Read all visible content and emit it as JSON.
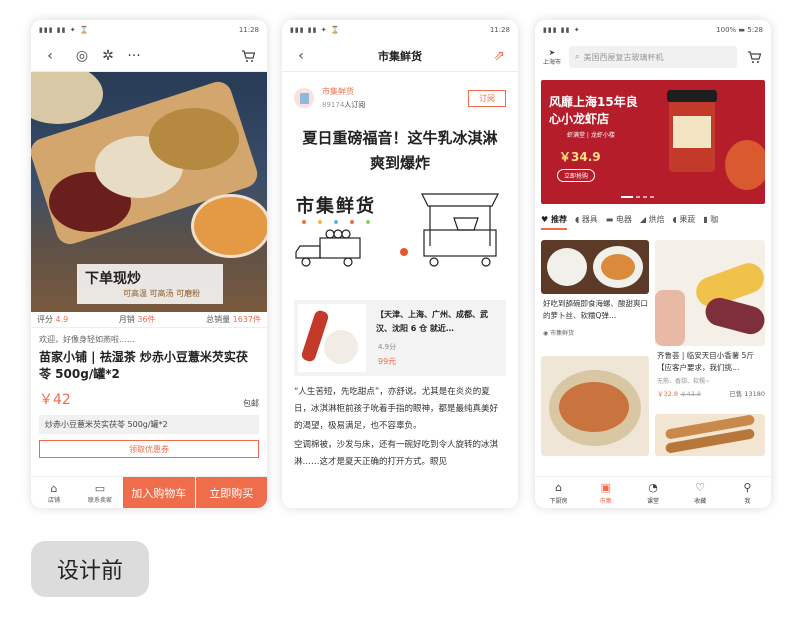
{
  "status_bar": {
    "time": "11:28",
    "time3": "5:28",
    "battery3": "100%"
  },
  "phone1": {
    "hero_title": "下单现炒",
    "hero_tags": "可高温  可高汤  可磨粉",
    "rating_label": "评分",
    "rating": "4.9",
    "sales_label": "月销",
    "sales": "36件",
    "total_label": "总销量",
    "total": "1637件",
    "note": "欢迎，好像身轻如燕啦……",
    "product_title": "苗家小铺 | 祛湿茶 炒赤小豆薏米芡实茯苓 500g/罐*2",
    "price": "￥42",
    "shipping": "包邮",
    "spec": "炒赤小豆薏米芡实茯苓 500g/罐*2",
    "coupon": "领取优惠券",
    "store_label": "店铺",
    "contact_label": "联系卖家",
    "add_cart": "加入购物车",
    "buy_now": "立即购买"
  },
  "phone2": {
    "title": "市集鲜货",
    "account_name": "市集鲜货",
    "subscribers": "89174",
    "subscribers_suffix": "人订阅",
    "subscribe": "订阅",
    "headline": "夏日重磅福音！这牛乳冰淇淋爽到爆炸",
    "brand": "市集鲜货",
    "card_title": "【天津、上海、广州、成都、武汉、沈阳 6 仓 就近…",
    "card_score": "4.9分",
    "card_price": "99元",
    "para1": "“人生苦短，先吃甜点”，亦舒说。尤其是在炎炎的夏日，冰淇淋柜前孩子吮着手指的眼神，都是最纯真美好的渴望，极易满足，也不容辜负。",
    "para2": "空调棉被，沙发与床，还有一碗好吃到令人旋转的冰淇淋……这才是夏天正确的打开方式。眼见"
  },
  "phone3": {
    "location": "上海市",
    "search_placeholder": "美国西屋复古玻璃杯机",
    "banner_title": "风靡上海15年良心小龙虾店",
    "banner_sub": "虾满堂 | 龙虾小楼",
    "banner_price": "￥34.9",
    "banner_btn": "立即抢购",
    "categories": [
      "推荐",
      "器具",
      "电器",
      "烘焙",
      "果蔬",
      "咖"
    ],
    "item1_title": "好吃到舔碗即食海螺、酸甜爽口的萝卜丝、软糯Q弹…",
    "item1_shop": "市集鲜货",
    "item2_title": "齐鲁荟 | 临安天目小香薯 5斤【应客户要求，我们挑…",
    "item2_tags": "无筋、香甜、软糯~",
    "item2_price": "￥32.8",
    "item2_old": "￥43.8",
    "item2_sold": "已售 13180",
    "tabs": [
      "下厨房",
      "市集",
      "课堂",
      "收藏",
      "我"
    ]
  },
  "caption": "设计前",
  "colors": {
    "accent": "#f06d4c",
    "banner": "#b51d2b"
  }
}
